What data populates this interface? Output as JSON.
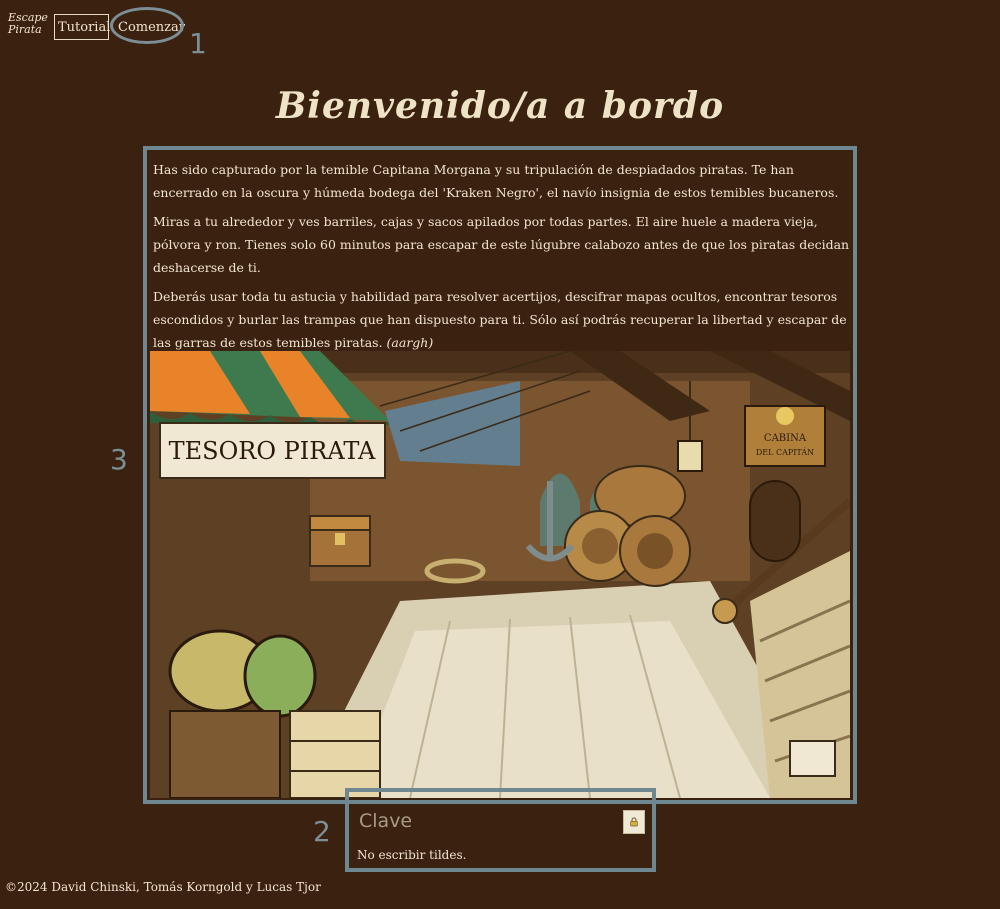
{
  "header": {
    "brand": "Escape Pirata",
    "tutorial_label": "Tutorial",
    "start_label": "Comenzar"
  },
  "annotations": {
    "one": "1",
    "two": "2",
    "three": "3"
  },
  "title": "Bienvenido/a a bordo",
  "story": {
    "p1": "Has sido capturado por la temible Capitana Morgana y su tripulación de despiadados piratas. Te han encerrado en la oscura y húmeda bodega del 'Kraken Negro', el navío insignia de estos temibles bucaneros.",
    "p2": "Miras a tu alrededor y ves barriles, cajas y sacos apilados por todas partes. El aire huele a madera vieja, pólvora y ron. Tienes solo 60 minutos para escapar de este lúgubre calabozo antes de que los piratas decidan deshacerse de ti.",
    "p3": "Deberás usar toda tu astucia y habilidad para resolver acertijos, descifrar mapas ocultos, encontrar tesoros escondidos y burlar las trampas que han dispuesto para ti. Sólo así podrás recuperar la libertad y escapar de las garras de estos temibles piratas. ",
    "p3_aside": "(aargh)"
  },
  "scene": {
    "sign": "TESORO PIRATA",
    "cabin_sign_1": "CABINA",
    "cabin_sign_2": "DEL CAPITÁN"
  },
  "password": {
    "placeholder": "Clave",
    "hint": "No escribir tildes.",
    "lock_icon": "lock-icon"
  },
  "footer": "©2024 David Chinski, Tomás Korngold y Lucas Tjor",
  "colors": {
    "background": "#3a2110",
    "annotation": "#7c8f97",
    "text": "#f2e6cc"
  }
}
